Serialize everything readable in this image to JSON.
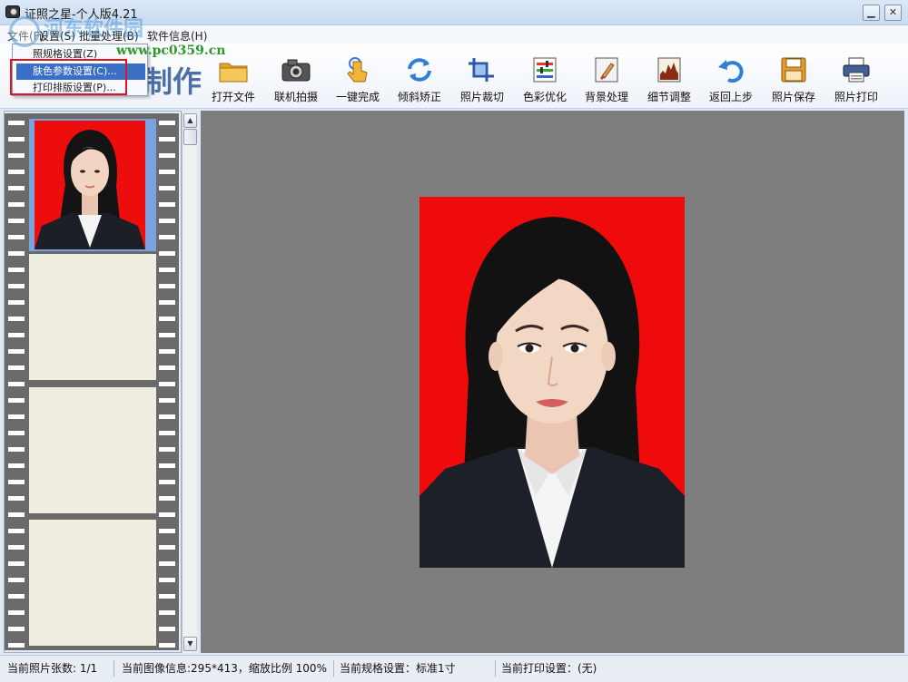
{
  "window": {
    "title": "证照之星-个人版4.21",
    "minimize_glyph": "▁",
    "close_glyph": "✕"
  },
  "watermark": {
    "text": "河东软件园",
    "url": "www.pc0359.cn"
  },
  "menubar": {
    "items": [
      {
        "label": "文件(F)"
      },
      {
        "label": "设置(S)"
      },
      {
        "label": "批量处理(B)"
      },
      {
        "label": "软件信息(H)"
      }
    ]
  },
  "settings_menu": {
    "items": [
      {
        "label": "照规格设置(Z)",
        "highlighted": false
      },
      {
        "label": "肤色参数设置(C)...",
        "highlighted": true
      },
      {
        "label": "打印排版设置(P)...",
        "highlighted": false
      }
    ]
  },
  "toolbar": {
    "brand": "制作",
    "buttons": [
      {
        "label": "打开文件",
        "icon": "folder-icon"
      },
      {
        "label": "联机拍摄",
        "icon": "camera-icon"
      },
      {
        "label": "一键完成",
        "icon": "hand-pointer-icon"
      },
      {
        "label": "倾斜矫正",
        "icon": "rotate-correct-icon"
      },
      {
        "label": "照片裁切",
        "icon": "crop-icon"
      },
      {
        "label": "色彩优化",
        "icon": "color-sliders-icon"
      },
      {
        "label": "背景处理",
        "icon": "background-brush-icon"
      },
      {
        "label": "细节调整",
        "icon": "histogram-icon"
      },
      {
        "label": "返回上步",
        "icon": "undo-icon"
      },
      {
        "label": "照片保存",
        "icon": "floppy-save-icon"
      },
      {
        "label": "照片打印",
        "icon": "printer-icon"
      }
    ]
  },
  "statusbar": {
    "photo_count": "当前照片张数: 1/1",
    "image_info": "当前图像信息:295*413，缩放比例 100%",
    "spec": "当前规格设置：标准1寸",
    "print_setting": "当前打印设置：(无)"
  },
  "colors": {
    "photo_background": "#ef0b0b",
    "canvas": "#7e7e7e",
    "menu_highlight": "#3b6fc6",
    "annotation_box": "#e0141e"
  }
}
